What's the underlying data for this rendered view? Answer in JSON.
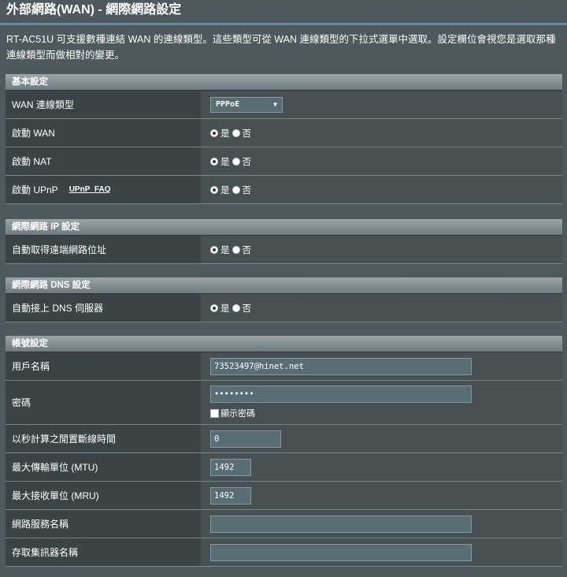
{
  "header": {
    "title": "外部網路(WAN) - 網際網路設定",
    "description": "RT-AC51U 可支援數種連結 WAN 的連線類型。這些類型可從 WAN 連線類型的下拉式選單中選取。設定欄位會視您是選取那種連線類型而做相對的變更。"
  },
  "options": {
    "yes": "是",
    "no": "否"
  },
  "basic": {
    "header": "基本設定",
    "wan_type_label": "WAN 連線類型",
    "wan_type_value": "PPPoE",
    "enable_wan_label": "啟動 WAN",
    "enable_nat_label": "啟動 NAT",
    "enable_upnp_label": "啟動 UPnP",
    "upnp_faq": "UPnP_FAQ"
  },
  "ip": {
    "header": "網際網路 IP 設定",
    "auto_ip_label": "自動取得遠端網路位址"
  },
  "dns": {
    "header": "網際網路 DNS 設定",
    "auto_dns_label": "自動接上 DNS 伺服器"
  },
  "account": {
    "header": "帳號設定",
    "username_label": "用戶名稱",
    "username_value": "73523497@hinet.net",
    "password_label": "密碼",
    "password_value": "••••••••",
    "show_password": "顯示密碼",
    "idle_label": "以秒計算之閒置斷線時間",
    "idle_value": "0",
    "mtu_label": "最大傳輸單位 (MTU)",
    "mtu_value": "1492",
    "mru_label": "最大接收單位 (MRU)",
    "mru_value": "1492",
    "service_label": "網路服務名稱",
    "service_value": "",
    "ac_label": "存取集訊器名稱",
    "ac_value": ""
  }
}
